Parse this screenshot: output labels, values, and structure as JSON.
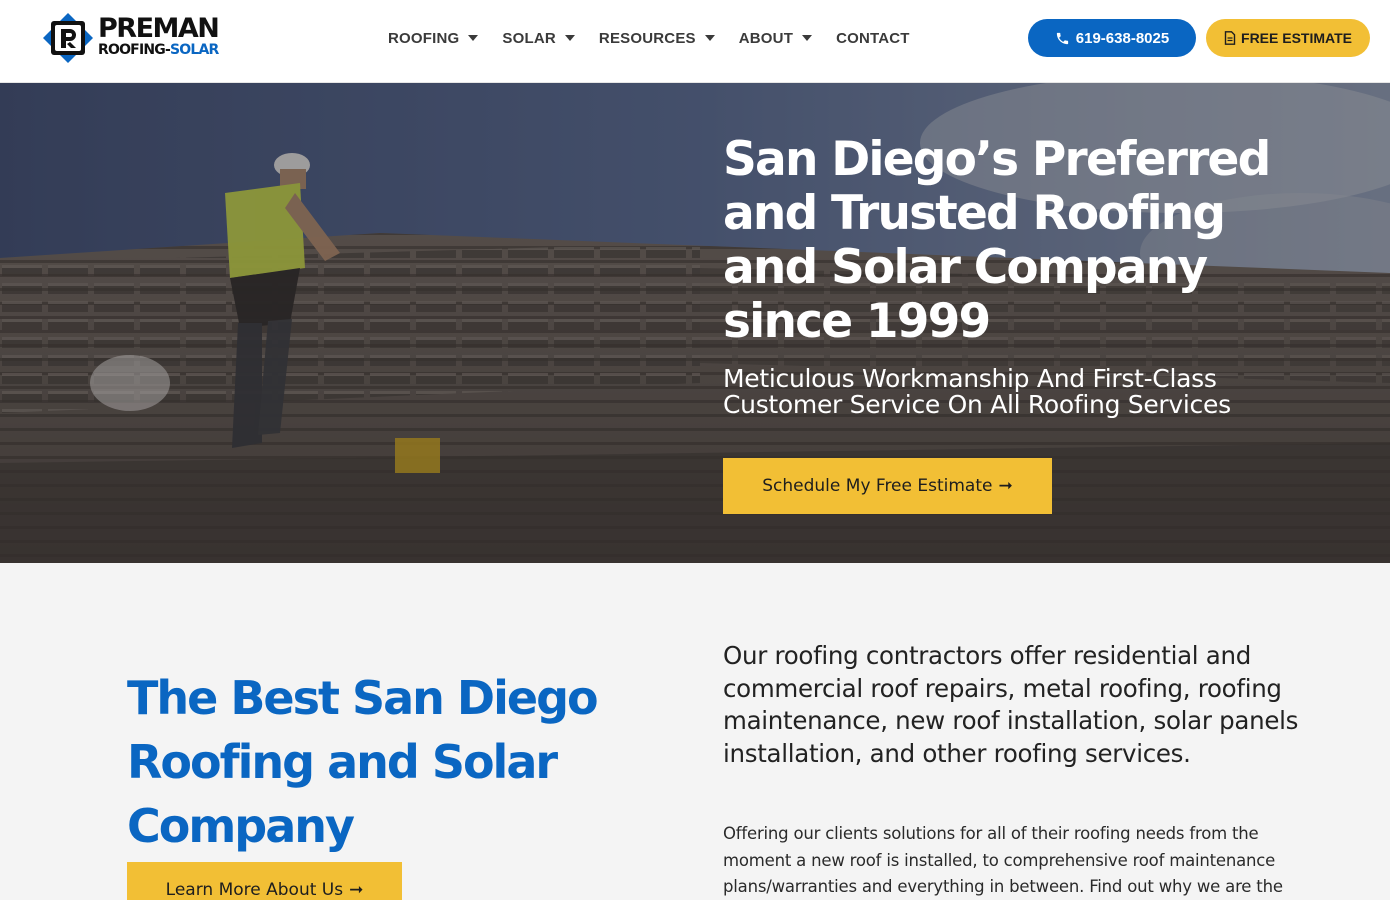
{
  "brand": {
    "name_top": "PREMAN",
    "name_bottom_1": "ROOFING",
    "name_bottom_sep": "-",
    "name_bottom_2": "SOLAR",
    "primary_color": "#0a66c2",
    "accent_color": "#f2bf35"
  },
  "nav": {
    "items": [
      {
        "label": "ROOFING",
        "has_dropdown": true
      },
      {
        "label": "SOLAR",
        "has_dropdown": true
      },
      {
        "label": "RESOURCES",
        "has_dropdown": true
      },
      {
        "label": "ABOUT",
        "has_dropdown": true
      },
      {
        "label": "CONTACT",
        "has_dropdown": false
      }
    ],
    "phone_label": "619-638-8025",
    "estimate_label": "FREE ESTIMATE"
  },
  "hero": {
    "title": "San Diego’s Preferred and Trusted Roofing and Solar Company since 1999",
    "subtitle": "Meticulous Workmanship And First-Class Customer Service On All Roofing Services",
    "cta_label": "Schedule My Free Estimate",
    "cta_icon": "arrow-right-icon"
  },
  "about": {
    "title": "The Best San Diego Roofing and Solar Company",
    "button_label": "Learn More About Us",
    "lead": "Our roofing contractors offer residential and commercial roof repairs, metal roofing, roofing maintenance, new roof installation, solar panels installation, and other roofing services.",
    "body": "Offering our clients solutions for all of their roofing needs from the moment a new roof is installed, to comprehensive roof maintenance plans/warranties and everything in between. Find out why we are the"
  }
}
